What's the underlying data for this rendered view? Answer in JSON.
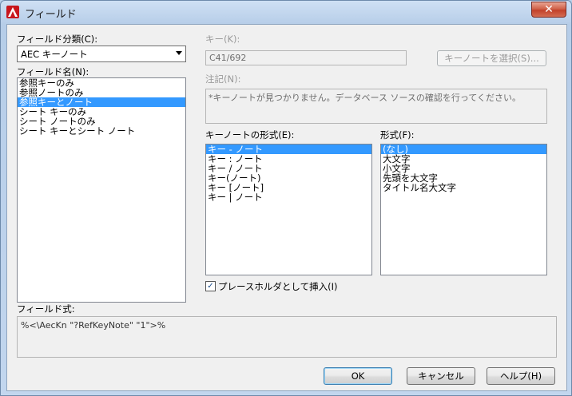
{
  "window": {
    "title": "フィールド",
    "close_label": "✕"
  },
  "field_category": {
    "label": "フィールド分類(C):",
    "selected": "AEC キーノート"
  },
  "field_names": {
    "label": "フィールド名(N):",
    "items": [
      "参照キーのみ",
      "参照ノートのみ",
      "参照キーとノート",
      "シート キーのみ",
      "シート ノートのみ",
      "シート キーとシート ノート"
    ],
    "selected_index": 2
  },
  "key": {
    "label": "キー(K):",
    "value": "C41/692",
    "select_button": "キーノートを選択(S)..."
  },
  "note": {
    "label": "注記(N):",
    "value": "*キーノートが見つかりません。データベース ソースの確認を行ってください。"
  },
  "keynote_format": {
    "label": "キーノートの形式(E):",
    "items": [
      "キー - ノート",
      "キー : ノート",
      "キー / ノート",
      "キー(ノート)",
      "キー [ノート]",
      "キー | ノート"
    ],
    "selected_index": 0
  },
  "format": {
    "label": "形式(F):",
    "items": [
      "(なし)",
      "大文字",
      "小文字",
      "先頭を大文字",
      "タイトル名大文字"
    ],
    "selected_index": 0
  },
  "placeholder_checkbox": {
    "label": "プレースホルダとして挿入(I)",
    "checked": true
  },
  "field_expression": {
    "label": "フィールド式:",
    "value": "%<\\AecKn \"?RefKeyNote\" \"1\">%"
  },
  "buttons": {
    "ok": "OK",
    "cancel": "キャンセル",
    "help": "ヘルプ(H)"
  }
}
